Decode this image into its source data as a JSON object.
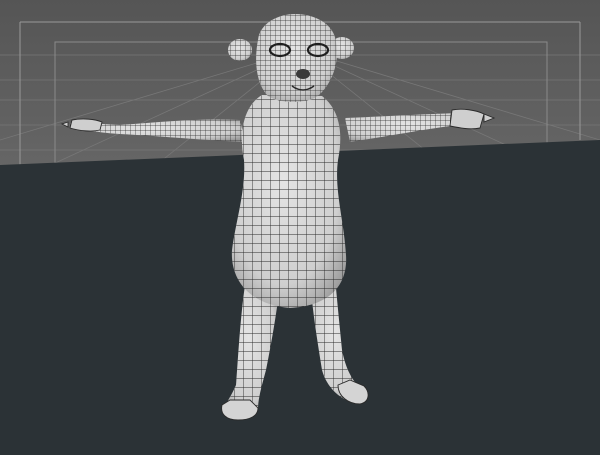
{
  "viewport": {
    "view_type": "perspective",
    "display_mode": "wireframe-on-shaded",
    "colors": {
      "sky": "#5b5b5b",
      "floor": "#2b3236",
      "grid_line": "#7a7a7a",
      "safe_frame": "#8a8a8a",
      "mesh_fill": "#d9d9d9",
      "mesh_shade": "#9c9c9c",
      "wire": "#2a2a2a"
    }
  },
  "scene": {
    "object": "meerkat-character-mesh",
    "pose": "t-pose"
  }
}
